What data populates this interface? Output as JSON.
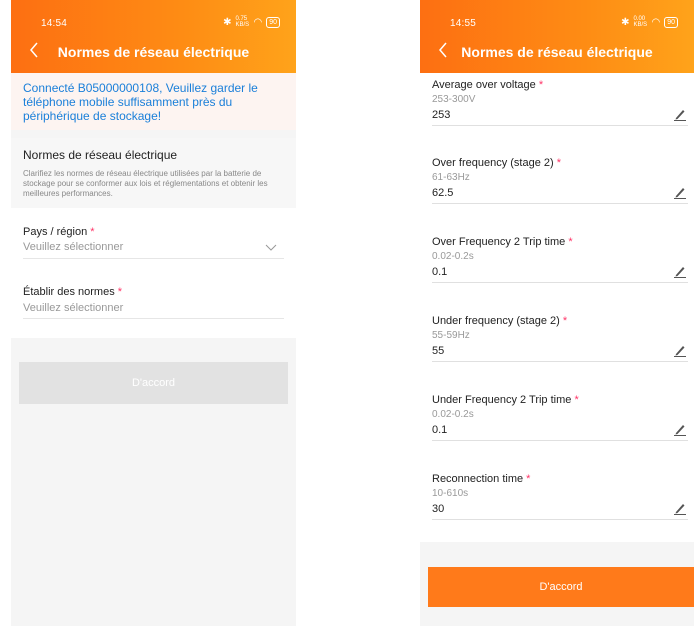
{
  "left": {
    "status_time": "14:54",
    "status_net": "0.75 KB/S",
    "battery": "90",
    "title": "Normes de réseau électrique",
    "notice": "Connecté B05000000108, Veuillez garder le téléphone mobile suffisamment près du périphérique de stockage!",
    "section_title": "Normes de réseau électrique",
    "section_desc": "Clarifiez les normes de réseau électrique utilisées par la batterie de stockage pour se conformer aux lois et réglementations et obtenir les meilleures performances.",
    "country_label": "Pays / région",
    "country_placeholder": "Veuillez sélectionner",
    "norms_label": "Établir des normes",
    "norms_placeholder": "Veuillez sélectionner",
    "button": "D'accord"
  },
  "right": {
    "status_time": "14:55",
    "status_net": "0.00 KB/S",
    "battery": "90",
    "title": "Normes de réseau électrique",
    "button": "D'accord",
    "fields": [
      {
        "label": "Average over voltage",
        "range": "253-300V",
        "value": "253"
      },
      {
        "label": "Over frequency (stage 2)",
        "range": "61-63Hz",
        "value": "62.5"
      },
      {
        "label": "Over Frequency 2 Trip time",
        "range": "0.02-0.2s",
        "value": "0.1"
      },
      {
        "label": "Under frequency (stage 2)",
        "range": "55-59Hz",
        "value": "55"
      },
      {
        "label": "Under Frequency 2 Trip time",
        "range": "0.02-0.2s",
        "value": "0.1"
      },
      {
        "label": "Reconnection time",
        "range": "10-610s",
        "value": "30"
      }
    ]
  },
  "required_mark": "*",
  "colors": {
    "accent": "#ff7a1a",
    "link": "#1a7fd9",
    "required": "#ff3366"
  }
}
